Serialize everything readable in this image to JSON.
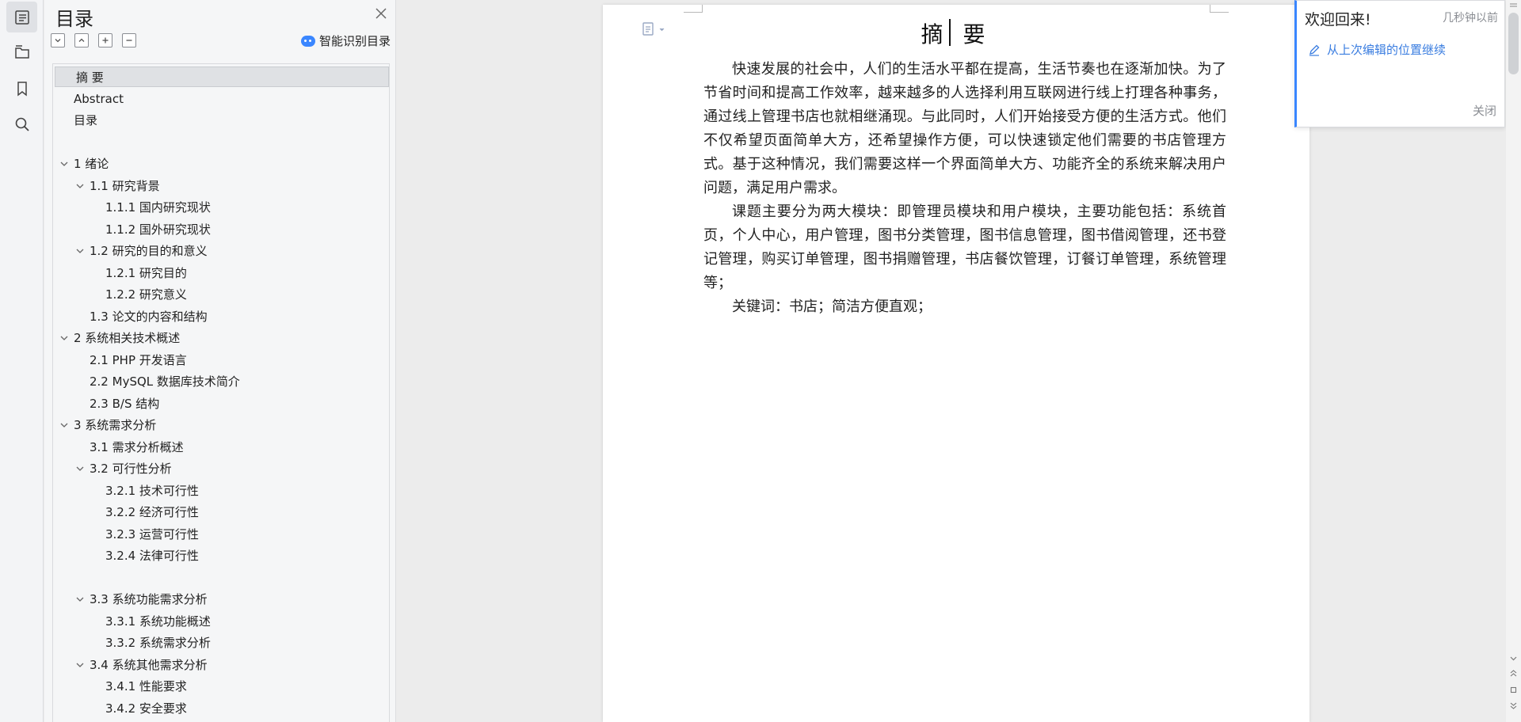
{
  "toc": {
    "title": "目录",
    "smart_label": "智能识别目录",
    "items": [
      {
        "label": "摘    要",
        "level": 0,
        "chevron": false,
        "selected": true
      },
      {
        "label": "Abstract",
        "level": 0,
        "chevron": false
      },
      {
        "label": "目录",
        "level": 0,
        "chevron": false
      },
      {
        "label": "",
        "level": 0,
        "chevron": false
      },
      {
        "label": "1 绪论",
        "level": 0,
        "chevron": true
      },
      {
        "label": "1.1  研究背景",
        "level": 1,
        "chevron": true
      },
      {
        "label": "1.1.1 国内研究现状",
        "level": 2,
        "chevron": false
      },
      {
        "label": "1.1.2 国外研究现状",
        "level": 2,
        "chevron": false
      },
      {
        "label": "1.2 研究的目的和意义",
        "level": 1,
        "chevron": true
      },
      {
        "label": "1.2.1 研究目的",
        "level": 2,
        "chevron": false
      },
      {
        "label": "1.2.2  研究意义",
        "level": 2,
        "chevron": false
      },
      {
        "label": "1.3  论文的内容和结构",
        "level": 1,
        "chevron": false
      },
      {
        "label": "2 系统相关技术概述",
        "level": 0,
        "chevron": true
      },
      {
        "label": "2.1 PHP 开发语言",
        "level": 1,
        "chevron": false
      },
      {
        "label": "2.2 MySQL 数据库技术简介",
        "level": 1,
        "chevron": false
      },
      {
        "label": "2.3 B/S 结构",
        "level": 1,
        "chevron": false
      },
      {
        "label": "3 系统需求分析",
        "level": 0,
        "chevron": true
      },
      {
        "label": "3.1 需求分析概述",
        "level": 1,
        "chevron": false
      },
      {
        "label": "3.2 可行性分析",
        "level": 1,
        "chevron": true
      },
      {
        "label": "3.2.1 技术可行性",
        "level": 2,
        "chevron": false
      },
      {
        "label": "3.2.2 经济可行性",
        "level": 2,
        "chevron": false
      },
      {
        "label": "3.2.3 运营可行性",
        "level": 2,
        "chevron": false
      },
      {
        "label": "3.2.4 法律可行性",
        "level": 2,
        "chevron": false
      },
      {
        "label": "",
        "level": 0,
        "chevron": false
      },
      {
        "label": "3.3 系统功能需求分析",
        "level": 1,
        "chevron": true
      },
      {
        "label": "3.3.1 系统功能概述",
        "level": 2,
        "chevron": false
      },
      {
        "label": "3.3.2 系统需求分析",
        "level": 2,
        "chevron": false
      },
      {
        "label": "3.4 系统其他需求分析",
        "level": 1,
        "chevron": true
      },
      {
        "label": "3.4.1 性能要求",
        "level": 2,
        "chevron": false
      },
      {
        "label": "3.4.2 安全要求",
        "level": 2,
        "chevron": false
      }
    ]
  },
  "document": {
    "title": "摘  要",
    "paragraphs": [
      "快速发展的社会中，人们的生活水平都在提高，生活节奏也在逐渐加快。为了节省时间和提高工作效率，越来越多的人选择利用互联网进行线上打理各种事务，通过线上管理书店也就相继涌现。与此同时，人们开始接受方便的生活方式。他们不仅希望页面简单大方，还希望操作方便，可以快速锁定他们需要的书店管理方式。基于这种情况，我们需要这样一个界面简单大方、功能齐全的系统来解决用户问题，满足用户需求。",
      "课题主要分为两大模块：即管理员模块和用户模块，主要功能包括：系统首页，个人中心，用户管理，图书分类管理，图书信息管理，图书借阅管理，还书登记管理，购买订单管理，图书捐赠管理，书店餐饮管理，订餐订单管理，系统管理等；",
      "关键词：书店；简洁方便直观；"
    ]
  },
  "popup": {
    "title": "欢迎回来!",
    "time": "几秒钟以前",
    "resume_label": "从上次编辑的位置继续",
    "close_label": "关闭"
  },
  "colors": {
    "accent": "#3a86ff",
    "link": "#3a7de0"
  }
}
